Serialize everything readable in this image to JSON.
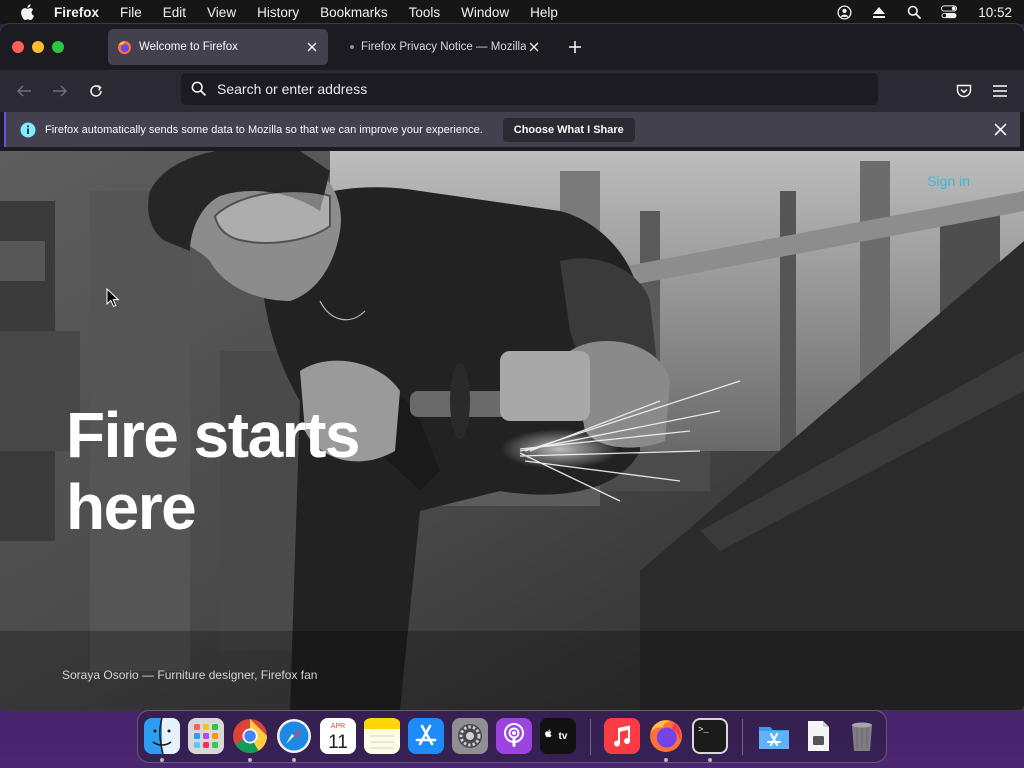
{
  "menubar": {
    "apple_icon": "apple-logo-icon",
    "app_name": "Firefox",
    "items": [
      "File",
      "Edit",
      "View",
      "History",
      "Bookmarks",
      "Tools",
      "Window",
      "Help"
    ],
    "status_icons": [
      "user-icon",
      "eject-icon",
      "spotlight-search-icon",
      "control-center-icon"
    ],
    "clock": "10:52"
  },
  "tabs": [
    {
      "title": "Welcome to Firefox",
      "active": true,
      "icon": "firefox-favicon-icon"
    },
    {
      "title": "Firefox Privacy Notice — Mozilla",
      "active": false
    }
  ],
  "navbar": {
    "search_placeholder": "Search or enter address"
  },
  "notice": {
    "text": "Firefox automatically sends some data to Mozilla so that we can improve your experience.",
    "button_label": "Choose What I Share"
  },
  "hero": {
    "sign_in": "Sign in",
    "headline_line1": "Fire starts",
    "headline_line2": "here",
    "caption": "Soraya Osorio — Furniture designer, Firefox fan"
  },
  "dock": {
    "items": [
      {
        "name": "Finder",
        "icon": "finder-icon"
      },
      {
        "name": "Launchpad",
        "icon": "launchpad-icon"
      },
      {
        "name": "Chrome",
        "icon": "chrome-icon"
      },
      {
        "name": "Safari",
        "icon": "safari-icon"
      },
      {
        "name": "Calendar",
        "icon": "calendar-icon",
        "month": "APR",
        "day": "11"
      },
      {
        "name": "Notes",
        "icon": "notes-icon"
      },
      {
        "name": "App Store",
        "icon": "app-store-icon"
      },
      {
        "name": "System Preferences",
        "icon": "system-preferences-icon"
      },
      {
        "name": "Podcasts",
        "icon": "podcasts-icon"
      },
      {
        "name": "Apple TV",
        "icon": "apple-tv-icon",
        "label": "tv"
      },
      {
        "name": "Music",
        "icon": "music-icon"
      },
      {
        "name": "Firefox",
        "icon": "firefox-icon"
      },
      {
        "name": "Terminal",
        "icon": "terminal-icon",
        "label": ">_"
      },
      {
        "name": "App Store Downloads",
        "icon": "app-store-folder-icon"
      },
      {
        "name": "Document",
        "icon": "document-icon"
      },
      {
        "name": "Trash",
        "icon": "trash-icon"
      }
    ]
  },
  "colors": {
    "accent_link": "#3fb6d6",
    "notice_bg": "#42414d",
    "toolbar_bg": "#2b2a33",
    "tab_strip_bg": "#1c1b22"
  }
}
